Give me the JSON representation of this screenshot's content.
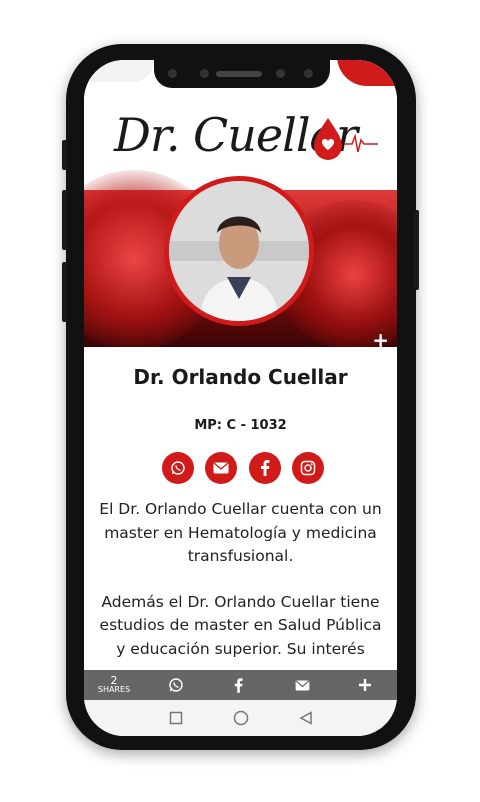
{
  "logo": {
    "text": "Dr. Cuellar"
  },
  "profile": {
    "name": "Dr. Orlando Cuellar",
    "license": "MP: C - 1032"
  },
  "socials": [
    {
      "icon": "whatsapp-icon"
    },
    {
      "icon": "envelope-icon"
    },
    {
      "icon": "facebook-icon"
    },
    {
      "icon": "instagram-icon"
    }
  ],
  "bio": {
    "p1": "El Dr. Orlando Cuellar cuenta con un master en Hematología y medicina transfusional.",
    "p2": "Además el Dr. Orlando Cuellar tiene estudios de master en Salud Pública y educación superior. Su interés"
  },
  "share_bar": {
    "count": "2",
    "count_label": "SHARES",
    "items": [
      "whatsapp-icon",
      "facebook-icon",
      "envelope-icon",
      "plus-icon"
    ]
  },
  "colors": {
    "accent": "#d11b1b",
    "share_bar": "#666666"
  }
}
